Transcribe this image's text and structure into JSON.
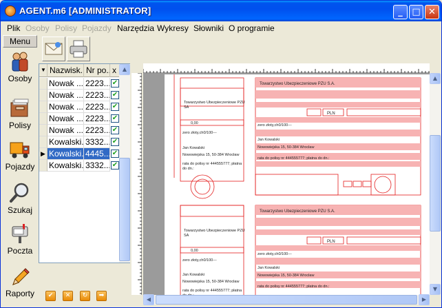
{
  "window": {
    "title": "AGENT.m6 [ADMINISTRATOR]",
    "min": "_",
    "max": "□",
    "close": "✕"
  },
  "menu": [
    {
      "label": "Plik",
      "disabled": false
    },
    {
      "label": "Osoby",
      "disabled": true
    },
    {
      "label": "Polisy",
      "disabled": true
    },
    {
      "label": "Pojazdy",
      "disabled": true
    },
    {
      "label": "Narzędzia",
      "disabled": false
    },
    {
      "label": "Wykresy",
      "disabled": false
    },
    {
      "label": "Słowniki",
      "disabled": false
    },
    {
      "label": "O programie",
      "disabled": false
    }
  ],
  "sidebar": {
    "header": "Menu",
    "items": [
      {
        "label": "Osoby",
        "icon": "people-icon"
      },
      {
        "label": "Polisy",
        "icon": "files-icon"
      },
      {
        "label": "Pojazdy",
        "icon": "truck-icon"
      },
      {
        "label": "Szukaj",
        "icon": "magnifier-icon"
      },
      {
        "label": "Poczta",
        "icon": "mailbox-icon"
      },
      {
        "label": "Raporty",
        "icon": "pencil-icon"
      }
    ]
  },
  "toolbar": {
    "buttons": [
      "envelope-icon",
      "printer-icon"
    ]
  },
  "grid": {
    "columns": [
      "Nazwisk...",
      "Nr po...",
      "x"
    ],
    "rows": [
      {
        "name": "Nowak ...",
        "nr": "2223...",
        "checked": true,
        "selected": false,
        "current": false
      },
      {
        "name": "Nowak ...",
        "nr": "2223...",
        "checked": true,
        "selected": false,
        "current": false
      },
      {
        "name": "Nowak ...",
        "nr": "2223...",
        "checked": true,
        "selected": false,
        "current": false
      },
      {
        "name": "Nowak ...",
        "nr": "2223...",
        "checked": true,
        "selected": false,
        "current": false
      },
      {
        "name": "Nowak ...",
        "nr": "2223...",
        "checked": true,
        "selected": false,
        "current": false
      },
      {
        "name": "Kowalski...",
        "nr": "3332...",
        "checked": true,
        "selected": false,
        "current": false
      },
      {
        "name": "Kowalski...",
        "nr": "4445...",
        "checked": true,
        "selected": true,
        "current": true
      },
      {
        "name": "Kowalski...",
        "nr": "3332...",
        "checked": true,
        "selected": false,
        "current": false
      }
    ]
  },
  "bottom_buttons": [
    "check-icon",
    "cancel-icon",
    "refresh-icon",
    "next-icon"
  ],
  "form": {
    "company": "Towarzystwo Ubezpieczeniowe PZU S.A.",
    "company_short_1": "Towarzystwo Ubezpieczeniowe PZU",
    "company_short_2": "SA",
    "currency": "PLN",
    "amount_left": "0,00",
    "amount_words": "zero złoty,ch0/100---",
    "payer_name": "Jan Kowalski",
    "payer_address": "Nowowiejska 15, 50-384 Wrocław",
    "title_left_1": "rata do polisy nr 444555777; płatna",
    "title_left_2": "do dn.:",
    "title_right": "rata do polisy nr 444555777; płatna do dn.:"
  },
  "colors": {
    "form_red": "#e31d1d",
    "form_pink": "#f7b3b3",
    "selection": "#316ac5"
  }
}
